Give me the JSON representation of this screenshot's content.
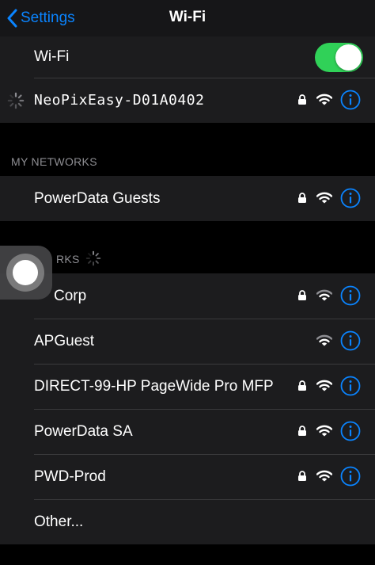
{
  "navbar": {
    "back_label": "Settings",
    "title": "Wi-Fi"
  },
  "wifi_toggle": {
    "label": "Wi-Fi",
    "on": true,
    "color": "#30d158"
  },
  "connecting_network": {
    "name": "NeoPixEasy-D01A0402",
    "secured": true
  },
  "my_networks": {
    "header": "MY NETWORKS",
    "items": [
      {
        "name": "PowerData Guests",
        "secured": true
      }
    ]
  },
  "networks": {
    "header": "NETWORKS",
    "header_visible": "RKS",
    "items": [
      {
        "name": "APCorp",
        "visible_text": "Corp",
        "secured": true
      },
      {
        "name": "APGuest",
        "secured": false
      },
      {
        "name": "DIRECT-99-HP PageWide Pro MFP",
        "secured": true
      },
      {
        "name": "PowerData SA",
        "secured": true
      },
      {
        "name": "PWD-Prod",
        "secured": true
      }
    ],
    "other_label": "Other..."
  },
  "colors": {
    "accent": "#0a84ff",
    "toggle_on": "#30d158",
    "background": "#000000",
    "cell": "#1c1c1e",
    "header_text": "#8e8e93"
  }
}
